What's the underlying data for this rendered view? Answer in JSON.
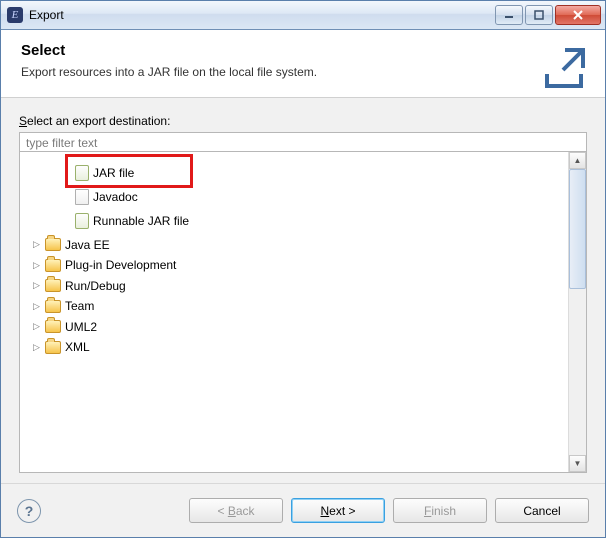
{
  "window": {
    "title": "Export"
  },
  "header": {
    "heading": "Select",
    "description": "Export resources into a JAR file on the local file system."
  },
  "body": {
    "destination_label_pre": "S",
    "destination_label_rest": "elect an export destination:",
    "filter_placeholder": "type filter text",
    "java_children": [
      {
        "id": "jar-file",
        "label": "JAR file",
        "icon": "jar"
      },
      {
        "id": "javadoc",
        "label": "Javadoc",
        "icon": "doc"
      },
      {
        "id": "runnable-jar-file",
        "label": "Runnable JAR file",
        "icon": "jar"
      }
    ],
    "top_folders": [
      {
        "id": "java-ee",
        "label": "Java EE"
      },
      {
        "id": "plug-in-development",
        "label": "Plug-in Development"
      },
      {
        "id": "run-debug",
        "label": "Run/Debug"
      },
      {
        "id": "team",
        "label": "Team"
      },
      {
        "id": "uml2",
        "label": "UML2"
      },
      {
        "id": "xml",
        "label": "XML"
      }
    ]
  },
  "footer": {
    "back": "< Back",
    "next": "Next >",
    "finish": "Finish",
    "cancel": "Cancel"
  }
}
